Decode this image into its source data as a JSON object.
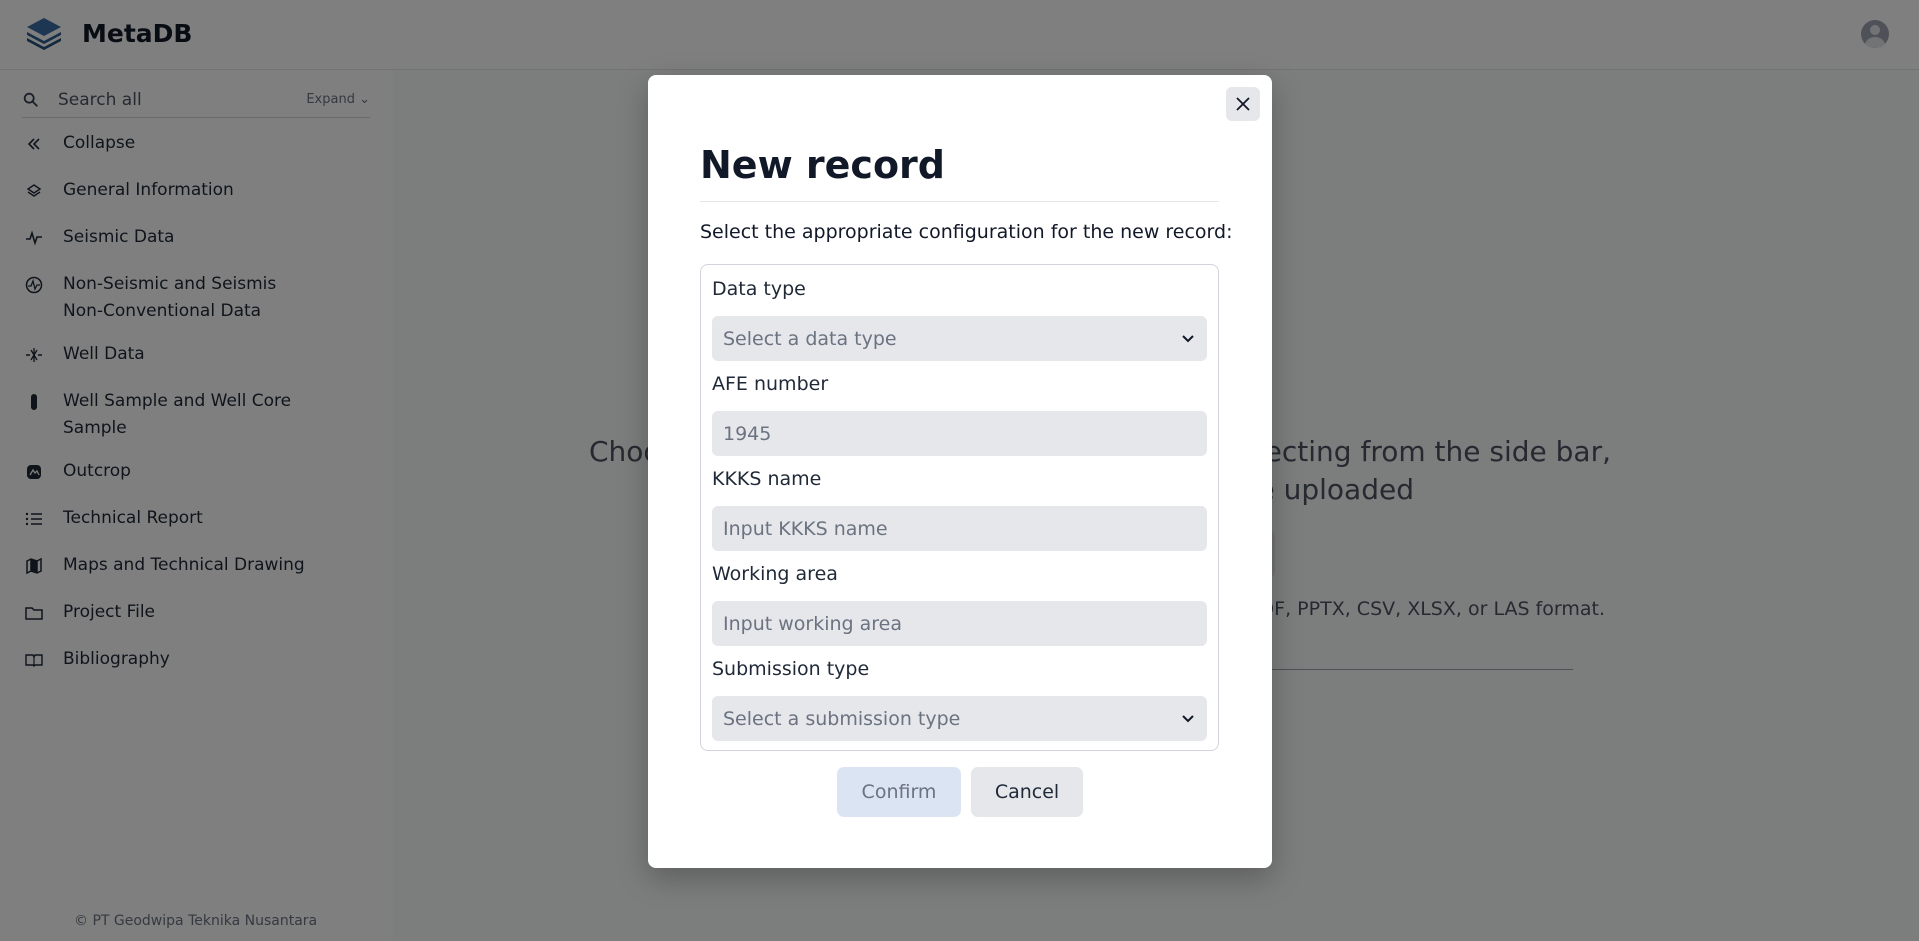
{
  "app": {
    "name": "MetaDB",
    "footer": "© PT Geodwipa Teknika Nusantara"
  },
  "sidebar": {
    "search_text": "Search all",
    "expand_label": "Expand ⌄",
    "items": [
      {
        "label": "Collapse",
        "icon": "double-chevron-left-icon"
      },
      {
        "label": "General Information",
        "icon": "layers-icon"
      },
      {
        "label": "Seismic Data",
        "icon": "waveform-icon"
      },
      {
        "label": "Non-Seismic and Seismis Non-Conventional Data",
        "icon": "gauge-icon"
      },
      {
        "label": "Well Data",
        "icon": "well-icon"
      },
      {
        "label": "Well Sample and Well Core Sample",
        "icon": "core-sample-icon"
      },
      {
        "label": "Outcrop",
        "icon": "outcrop-icon"
      },
      {
        "label": "Technical Report",
        "icon": "list-icon"
      },
      {
        "label": "Maps and Technical Drawing",
        "icon": "map-icon"
      },
      {
        "label": "Project File",
        "icon": "folder-icon"
      },
      {
        "label": "Bibliography",
        "icon": "book-icon"
      }
    ]
  },
  "main": {
    "heading_left": "Choo",
    "heading_right_1": "wn by selecting from the side bar,",
    "heading_right_2": "e to be uploaded",
    "note_right": "DF, PPTX, CSV, XLSX, or LAS format."
  },
  "modal": {
    "title": "New record",
    "description": "Select the appropriate configuration for the new record:",
    "fields": {
      "data_type": {
        "label": "Data type",
        "placeholder": "Select a data type"
      },
      "afe_number": {
        "label": "AFE number",
        "placeholder": "1945"
      },
      "kkks_name": {
        "label": "KKKS name",
        "placeholder": "Input KKKS name"
      },
      "working_area": {
        "label": "Working area",
        "placeholder": "Input working area"
      },
      "submission_type": {
        "label": "Submission type",
        "placeholder": "Select a submission type"
      }
    },
    "confirm_label": "Confirm",
    "cancel_label": "Cancel"
  },
  "colors": {
    "overlay": "#00000080",
    "confirm_bg": "#dbe4f3",
    "field_bg": "#e5e7eb"
  }
}
